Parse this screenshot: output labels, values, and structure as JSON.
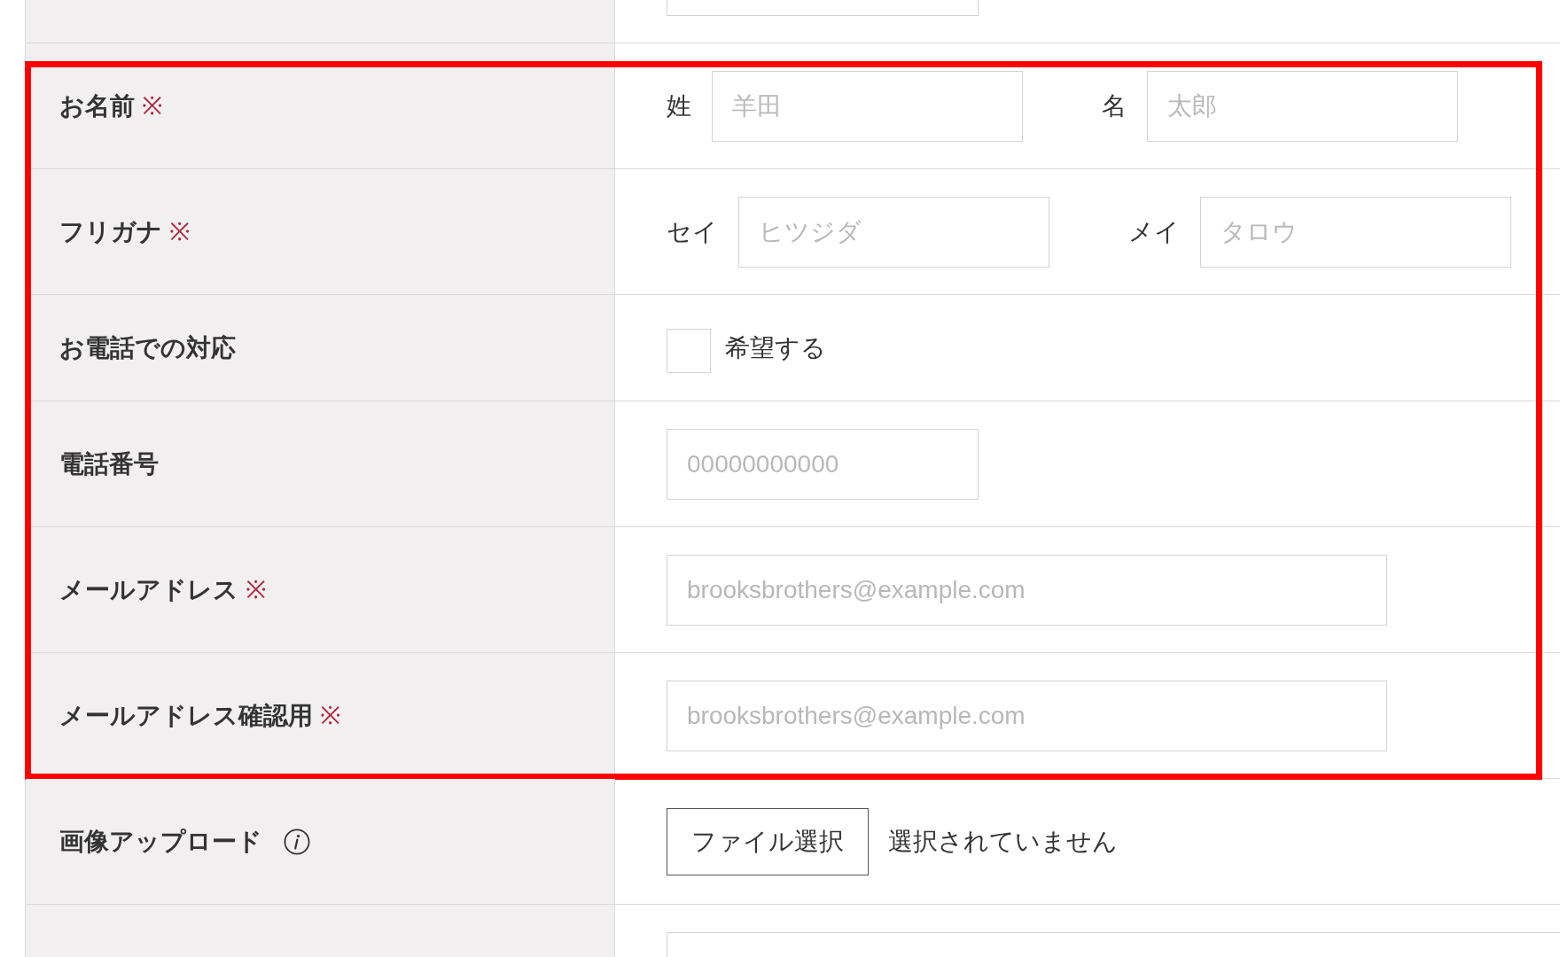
{
  "form": {
    "sections": [
      {
        "highlighted": false,
        "rows": [
          {
            "kind": "clipped_top"
          }
        ]
      },
      {
        "highlighted": true,
        "rows": [
          {
            "kind": "name_pair",
            "label": "お名前",
            "required_mark": "※",
            "fields": [
              {
                "label": "姓",
                "placeholder": "羊田"
              },
              {
                "label": "名",
                "placeholder": "太郎"
              }
            ]
          },
          {
            "kind": "name_pair",
            "label": "フリガナ",
            "required_mark": "※",
            "fields": [
              {
                "label": "セイ",
                "placeholder": "ヒツジダ"
              },
              {
                "label": "メイ",
                "placeholder": "タロウ"
              }
            ]
          },
          {
            "kind": "checkbox",
            "label": "お電話での対応",
            "option": {
              "label": "希望する",
              "checked": false
            }
          },
          {
            "kind": "short_text",
            "label": "電話番号",
            "placeholder": "00000000000"
          },
          {
            "kind": "long_text",
            "label": "メールアドレス",
            "required_mark": "※",
            "placeholder": "brooksbrothers@example.com"
          },
          {
            "kind": "long_text",
            "label": "メールアドレス確認用",
            "required_mark": "※",
            "placeholder": "brooksbrothers@example.com"
          }
        ]
      },
      {
        "highlighted": false,
        "rows": [
          {
            "kind": "file",
            "label": "画像アップロード",
            "info": true,
            "button": "ファイル選択",
            "status": "選択されていません"
          },
          {
            "kind": "clipped_bottom"
          }
        ]
      }
    ]
  }
}
